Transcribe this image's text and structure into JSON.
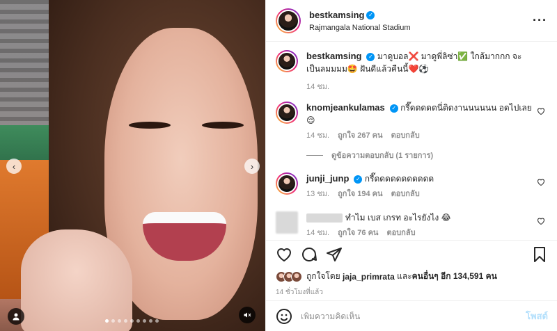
{
  "post": {
    "username": "bestkamsing",
    "location": "Rajmangala National Stadium",
    "verified": true
  },
  "media": {
    "slide_count": 9,
    "active_slide": 0
  },
  "caption": {
    "username": "bestkamsing",
    "text": "มาดูบอล❌ มาดูพี่ลิซ่า✅ ใกล้มากกก จะเป็นลมมมม🤩 ฝันดีแล้วคืนนี้❤️⚽",
    "time": "14 ชม."
  },
  "comments": [
    {
      "username": "knomjeankulamas",
      "verified": true,
      "text": "กรี๊ดดดดดนี่ติดงานนนนนน อดไปเลย😌",
      "time": "14 ชม.",
      "likes": "ถูกใจ 267 คน",
      "reply_label": "ตอบกลับ",
      "view_replies": "ดูข้อความตอบกลับ (1 รายการ)"
    },
    {
      "username": "junji_junp",
      "verified": true,
      "text": "กรี๊ดดดดดดดดดดด",
      "time": "13 ชม.",
      "likes": "ถูกใจ 194 คน",
      "reply_label": "ตอบกลับ"
    },
    {
      "username": "",
      "verified": false,
      "text": "ทำไม เบส เกรท อะไรยังไง 😂",
      "time": "14 ชม.",
      "likes": "ถูกใจ 76 คน",
      "reply_label": "ตอบกลับ"
    }
  ],
  "likes_summary": {
    "prefix": "ถูกใจโดย",
    "user": "jaja_primrata",
    "middle": "และ",
    "others": "คนอื่นๆ อีก 134,591 คน"
  },
  "posted_time": "14 ชั่วโมงที่แล้ว",
  "add_comment": {
    "placeholder": "เพิ่มความคิดเห็น",
    "post_label": "โพสต์"
  },
  "icons": {
    "more": "more-horizontal-icon",
    "like": "heart-icon",
    "comment": "comment-icon",
    "share": "share-icon",
    "save": "bookmark-icon",
    "emoji": "emoji-icon",
    "tag": "tag-user-icon",
    "mute": "mute-icon"
  },
  "colors": {
    "verified": "#0095f6",
    "post_button": "#b2dffc",
    "secondary_text": "#8e8e8e"
  }
}
